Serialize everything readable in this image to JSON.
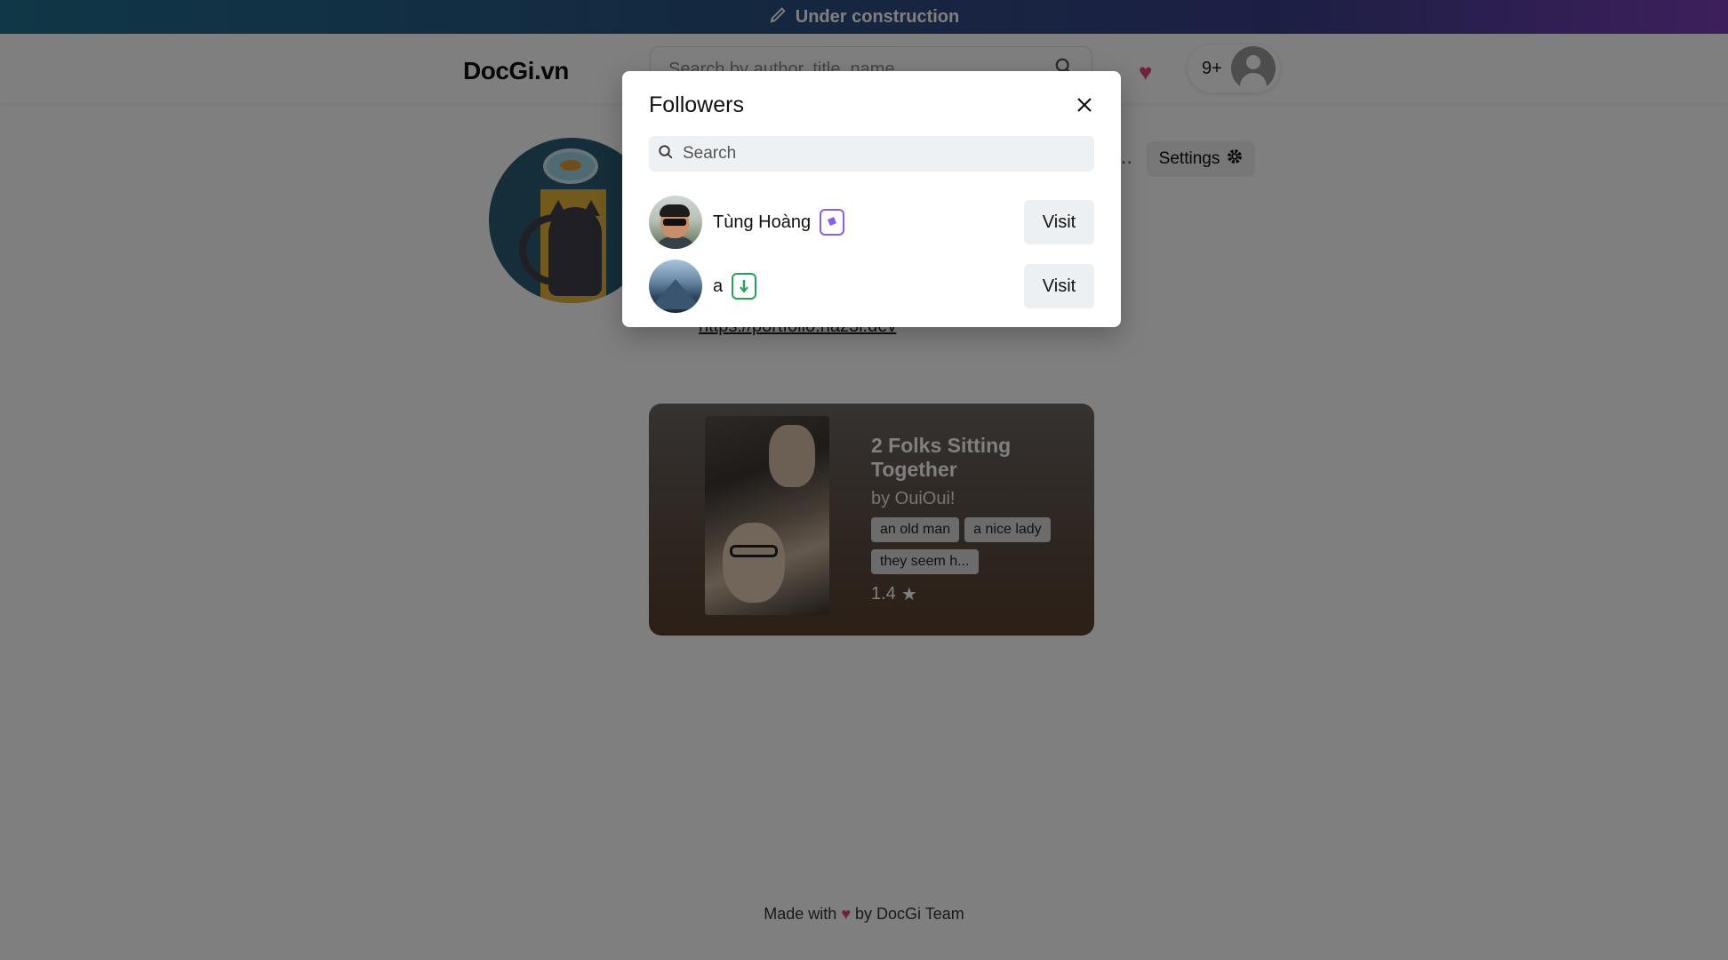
{
  "banner": {
    "text": "Under construction",
    "icon": "pencil-icon"
  },
  "header": {
    "logo": "DocGi.vn",
    "search_placeholder": "Search by author, title, name",
    "notification_count": "9+"
  },
  "profile": {
    "more_label": "⋯",
    "settings_label": "Settings",
    "link": "https://portfolio.haz3l.dev"
  },
  "book": {
    "title": "2 Folks Sitting Together",
    "author": "by OuiOui!",
    "tags": [
      "an old man",
      "a nice lady",
      "they seem h..."
    ],
    "rating": "1.4"
  },
  "footer": {
    "made_with": "Made with",
    "by": "by DocGi Team"
  },
  "modal": {
    "title": "Followers",
    "search_placeholder": "Search",
    "followers": [
      {
        "name": "Tùng Hoàng",
        "badge": "purple",
        "visit_label": "Visit"
      },
      {
        "name": "a",
        "badge": "green",
        "visit_label": "Visit"
      }
    ]
  },
  "colors": {
    "accent_heart": "#e0457a",
    "badge_purple": "#8b5cf6",
    "badge_green": "#22a35a"
  }
}
